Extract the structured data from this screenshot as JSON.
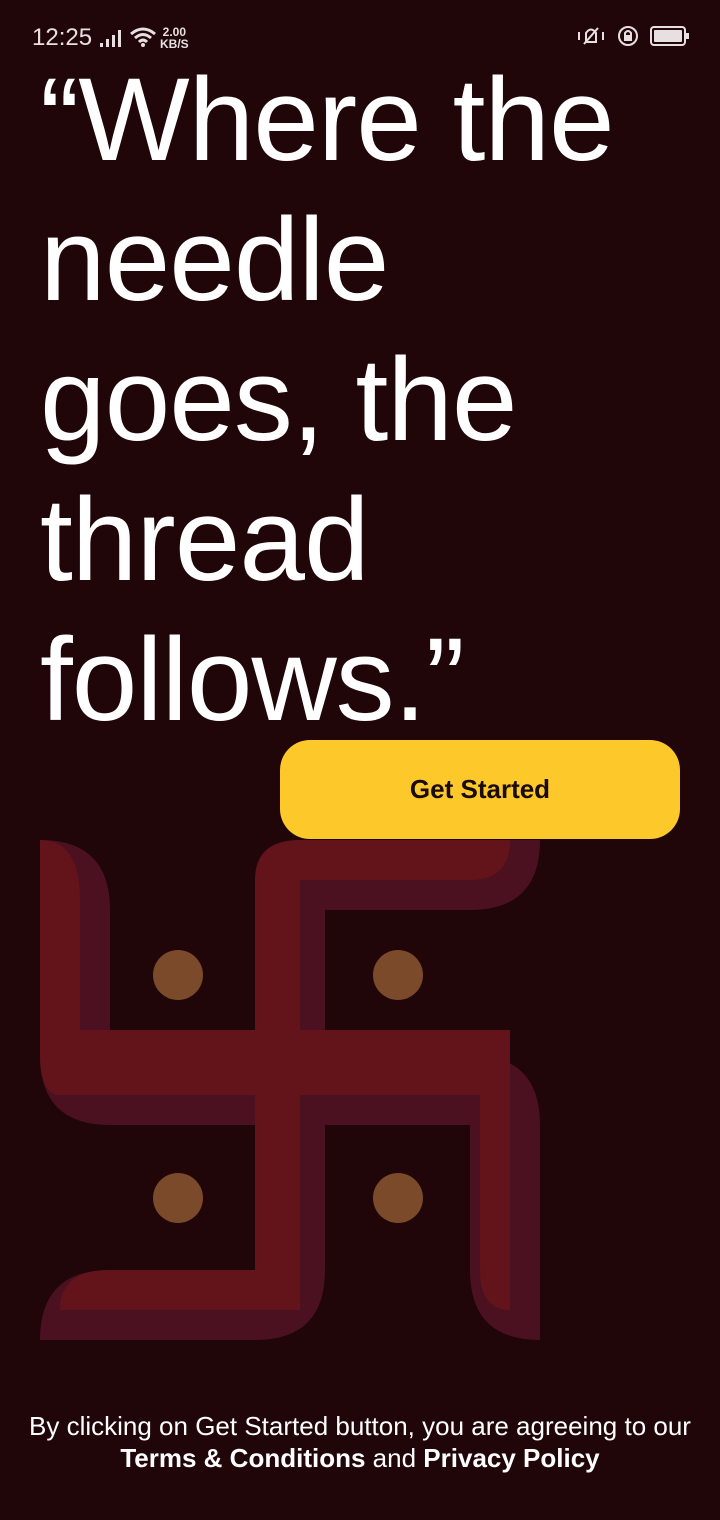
{
  "status_bar": {
    "time": "12:25",
    "net_speed_value": "2.00",
    "net_speed_unit": "KB/S",
    "icons": [
      "signal-icon",
      "wifi-icon",
      "vibrate-icon",
      "rotation-lock-icon",
      "battery-icon"
    ]
  },
  "hero": {
    "quote": "“Where the needle goes, the thread follows.”"
  },
  "cta": {
    "label": "Get Started",
    "color": "#fdc82a"
  },
  "footer": {
    "prefix": "By clicking on Get Started button, you are agreeing to our",
    "terms_label": "Terms & Conditions",
    "conjunction": "and",
    "privacy_label": "Privacy Policy"
  },
  "colors": {
    "background": "#200608",
    "symbol_primary": "#62141a",
    "symbol_shadow": "#4c1120",
    "dots": "#7a4a2a"
  }
}
